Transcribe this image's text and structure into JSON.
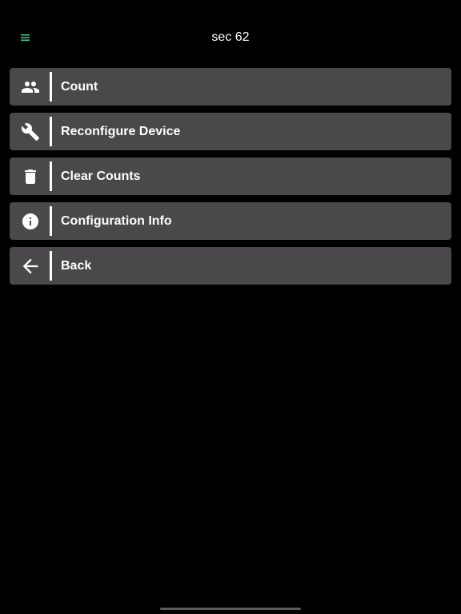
{
  "header": {
    "title": "sec 62",
    "menu_icon": "hamburger-menu-icon",
    "menu_icon_color": "#3fd29a"
  },
  "menu": {
    "items": [
      {
        "label": "Count",
        "icon": "people-icon"
      },
      {
        "label": "Reconfigure Device",
        "icon": "wrench-icon"
      },
      {
        "label": "Clear Counts",
        "icon": "trash-icon"
      },
      {
        "label": "Configuration Info",
        "icon": "info-icon"
      },
      {
        "label": "Back",
        "icon": "arrow-back-icon"
      }
    ]
  },
  "colors": {
    "background": "#000000",
    "item_background": "#4a484a",
    "text": "#ffffff"
  }
}
